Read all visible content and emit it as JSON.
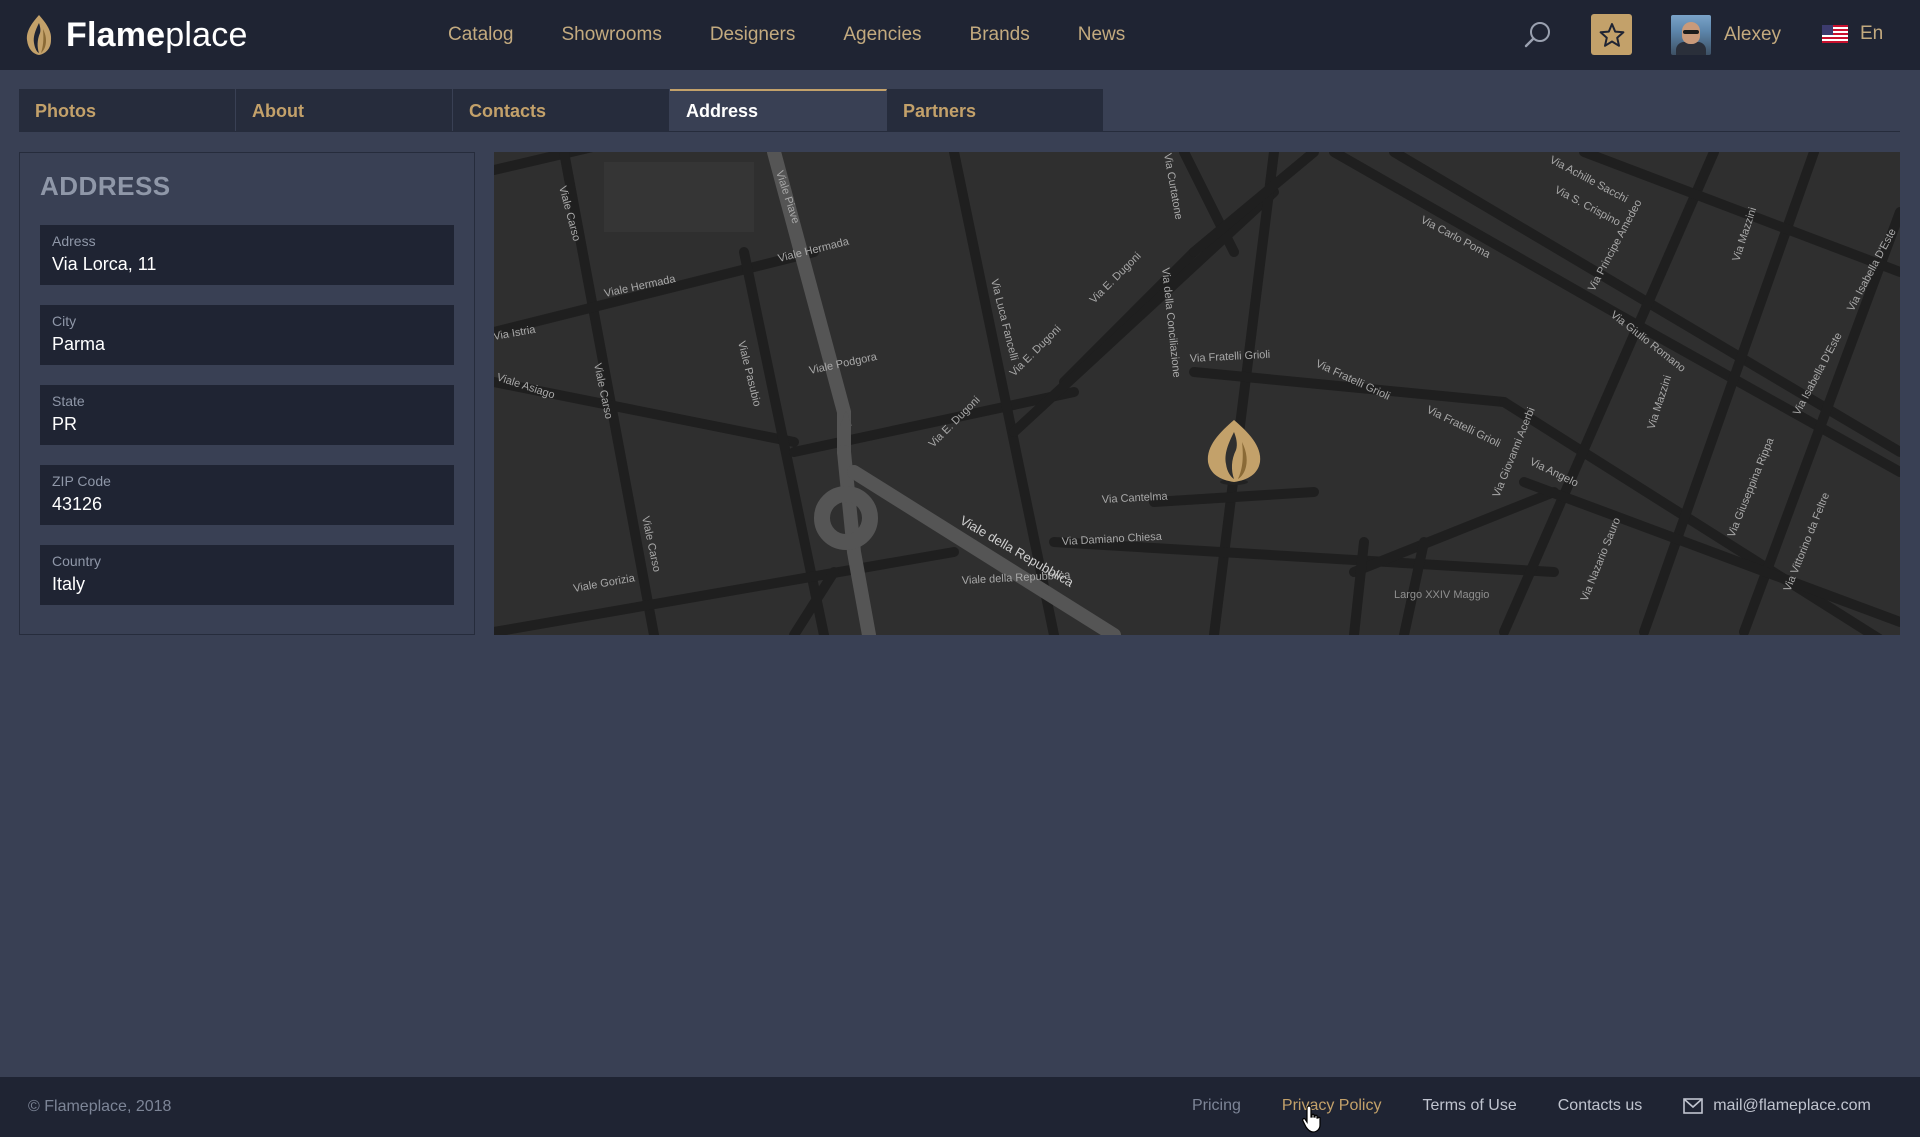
{
  "header": {
    "logo_bold": "Flame",
    "logo_light": "place",
    "nav": [
      "Catalog",
      "Showrooms",
      "Designers",
      "Agencies",
      "Brands",
      "News"
    ],
    "user_name": "Alexey",
    "language": "En"
  },
  "tabs": [
    {
      "label": "Photos",
      "active": false
    },
    {
      "label": "About",
      "active": false
    },
    {
      "label": "Contacts",
      "active": false
    },
    {
      "label": "Address",
      "active": true
    },
    {
      "label": "Partners",
      "active": false
    }
  ],
  "address_panel": {
    "title": "ADDRESS",
    "fields": [
      {
        "label": "Adress",
        "value": "Via Lorca, 11"
      },
      {
        "label": "City",
        "value": "Parma"
      },
      {
        "label": "State",
        "value": "PR"
      },
      {
        "label": "ZIP Code",
        "value": "43126"
      },
      {
        "label": "Country",
        "value": "Italy"
      }
    ]
  },
  "map": {
    "streets": [
      "Viale Piave",
      "Viale Hermada",
      "Viale Carso",
      "Via Istria",
      "Viale Asiago",
      "Viale Pasubio",
      "Viale Podgora",
      "Viale Gorizia",
      "Via Luca Fancelli",
      "Via E. Dugoni",
      "Via della Conciliazione",
      "Via Curtatone",
      "Via Fratelli Grioli",
      "Via Cantelma",
      "Via Damiano Chiesa",
      "Viale della Repubblica",
      "Largo XXIV Maggio",
      "Via Achille Sacchi",
      "Via S. Crispino",
      "Via Carlo Poma",
      "Via Principe Amedeo",
      "Via Giulio Romano",
      "Via Mazzini",
      "Via Isabella D'Este",
      "Via Giovanni Acerbi",
      "Via Angelo",
      "Via Nazario Sauro",
      "Via Giuseppina Rippa",
      "Via Vittorino da Feltre"
    ]
  },
  "footer": {
    "copyright": "© Flameplace, 2018",
    "links": [
      {
        "label": "Pricing",
        "style": "muted"
      },
      {
        "label": "Privacy Policy",
        "style": "accent"
      },
      {
        "label": "Terms of Use",
        "style": "normal"
      },
      {
        "label": "Contacts us",
        "style": "normal"
      }
    ],
    "email": "mail@flameplace.com"
  },
  "colors": {
    "accent": "#c3a16a",
    "background": "#394054",
    "header": "#1f2433",
    "map": "#2e2e2e"
  },
  "icons": [
    "flame-logo-icon",
    "search-icon",
    "star-icon",
    "us-flag-icon",
    "map-pin-flame-icon",
    "mail-icon",
    "hand-cursor-icon"
  ]
}
